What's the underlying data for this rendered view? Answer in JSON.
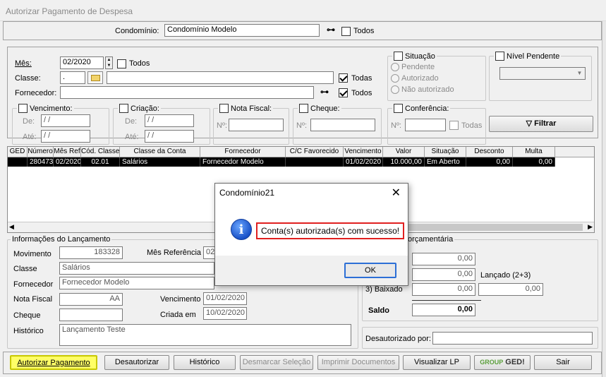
{
  "window": {
    "title": "Autorizar Pagamento de Despesa"
  },
  "condominio": {
    "label": "Condomínio:",
    "value": "Condomínio Modelo",
    "todos_label": "Todos"
  },
  "filters": {
    "mes_label": "Mês:",
    "mes_value": "02/2020",
    "mes_todos_label": "Todos",
    "classe_label": "Classe:",
    "classe_code": ".",
    "classe_desc": "",
    "classe_todas_label": "Todas",
    "fornecedor_label": "Fornecedor:",
    "fornecedor_value": "",
    "fornecedor_todos_label": "Todos",
    "situacao": {
      "label": "Situação",
      "options": [
        "Pendente",
        "Autorizado",
        "Não autorizado"
      ]
    },
    "nivel_pendente": {
      "label": "Nível Pendente",
      "value": ""
    },
    "vencimento": {
      "label": "Vencimento:",
      "de_label": "De:",
      "ate_label": "Até:",
      "de_value": "/ /",
      "ate_value": "/ /"
    },
    "criacao": {
      "label": "Criação:",
      "de_label": "De:",
      "ate_label": "Até:",
      "de_value": "/ /",
      "ate_value": "/ /"
    },
    "nota_fiscal": {
      "label": "Nota Fiscal:",
      "n_label": "Nº:",
      "value": ""
    },
    "cheque": {
      "label": "Cheque:",
      "n_label": "Nº:",
      "value": ""
    },
    "conferencia": {
      "label": "Conferência:",
      "n_label": "Nº:",
      "value": "",
      "todas_label": "Todas"
    },
    "filtrar_label": "Filtrar"
  },
  "grid": {
    "columns": [
      "GED",
      "Número",
      "Mês Ref",
      "Cód. Classe",
      "Classe da Conta",
      "Fornecedor",
      "C/C Favorecido",
      "Vencimento",
      "Valor",
      "Situação",
      "Desconto",
      "Multa"
    ],
    "rows": [
      {
        "ged": "",
        "numero": "280473",
        "mes_ref": "02/2020",
        "cod_classe": "02.01",
        "classe_conta": "Salários",
        "fornecedor": "Fornecedor Modelo",
        "cc_favorecido": "",
        "vencimento": "01/02/2020",
        "valor": "10.000,00",
        "situacao": "Em Aberto",
        "desconto": "0,00",
        "multa": "0,00"
      }
    ]
  },
  "info": {
    "title": "Informações do Lançamento",
    "movimento_label": "Movimento",
    "movimento_value": "183328",
    "mes_referencia_label": "Mês Referência",
    "mes_referencia_value": "02",
    "classe_label": "Classe",
    "classe_value": "Salários",
    "fornecedor_label": "Fornecedor",
    "fornecedor_value": "Fornecedor Modelo",
    "nota_fiscal_label": "Nota Fiscal",
    "nota_fiscal_value": "AA",
    "vencimento_label": "Vencimento",
    "vencimento_value": "01/02/2020",
    "cheque_label": "Cheque",
    "cheque_value": "",
    "criada_em_label": "Criada em",
    "criada_em_value": "10/02/2020",
    "historico_label": "Histórico",
    "historico_value": "Lançamento Teste"
  },
  "orcamentaria": {
    "title": "orçamentária",
    "v1": "0,00",
    "v2": "0,00",
    "lancado_label": "Lançado (2+3)",
    "baixado_label": "3) Baixado",
    "v3": "0,00",
    "lancado_value": "0,00",
    "saldo_label": "Saldo",
    "saldo_value": "0,00",
    "desautorizado_label": "Desautorizado por:",
    "desautorizado_value": ""
  },
  "buttons": {
    "autorizar": "Autorizar Pagamento",
    "desautorizar": "Desautorizar",
    "historico": "Histórico",
    "desmarcar": "Desmarcar Seleção",
    "imprimir": "Imprimir Documentos",
    "visualizar": "Visualizar LP",
    "ged_group": "GROUP",
    "ged_label": "GED!",
    "sair": "Sair"
  },
  "dialog": {
    "title": "Condomínio21",
    "close": "✕",
    "message": "Conta(s) autorizada(s) com sucesso!",
    "ok": "OK"
  }
}
